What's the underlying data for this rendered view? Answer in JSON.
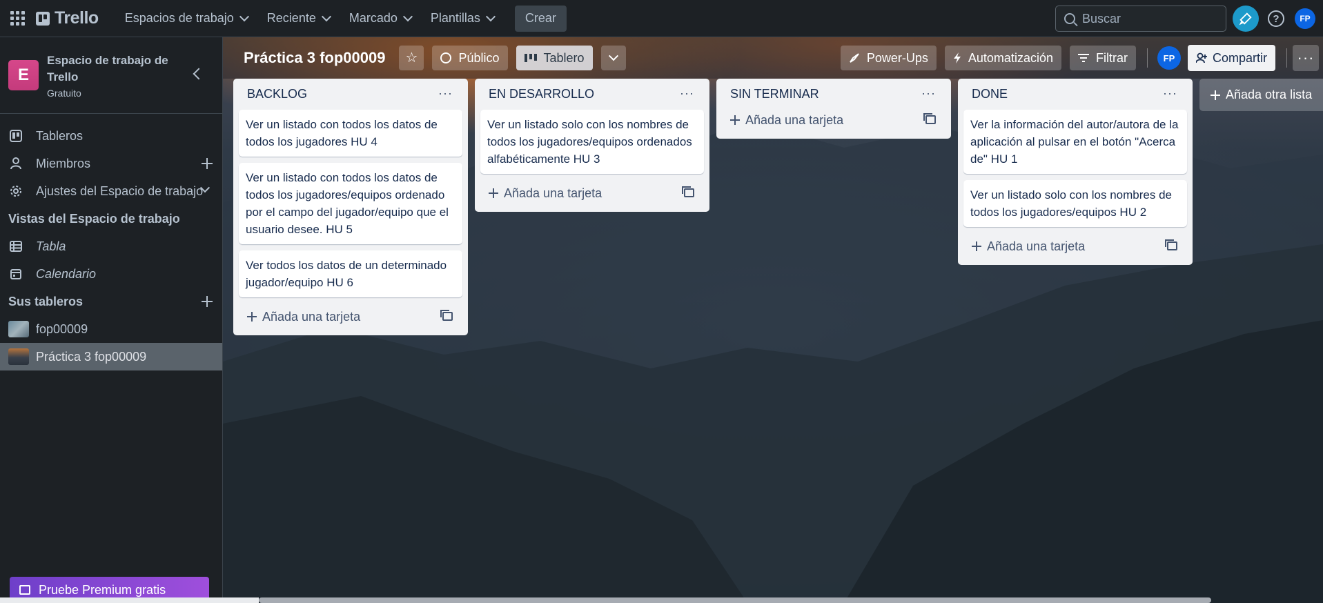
{
  "topbar": {
    "logo": "Trello",
    "nav": [
      "Espacios de trabajo",
      "Reciente",
      "Marcado",
      "Plantillas"
    ],
    "create": "Crear",
    "search_placeholder": "Buscar",
    "avatar": "FP"
  },
  "sidebar": {
    "workspace_initial": "E",
    "workspace_name": "Espacio de trabajo de Trello",
    "workspace_plan": "Gratuito",
    "items": {
      "boards": "Tableros",
      "members": "Miembros",
      "settings": "Ajustes del Espacio de trabajo"
    },
    "views_title": "Vistas del Espacio de trabajo",
    "views": {
      "table": "Tabla",
      "calendar": "Calendario"
    },
    "your_boards_title": "Sus tableros",
    "boards": [
      "fop00009",
      "Práctica 3 fop00009"
    ],
    "premium": "Pruebe Premium gratis"
  },
  "board": {
    "title": "Práctica 3 fop00009",
    "visibility": "Público",
    "view": "Tablero",
    "powerups": "Power-Ups",
    "automation": "Automatización",
    "filter": "Filtrar",
    "avatar": "FP",
    "share": "Compartir",
    "add_list": "Añada otra lista",
    "add_card": "Añada una tarjeta",
    "lists": [
      {
        "title": "BACKLOG",
        "cards": [
          "Ver un listado con todos los datos de todos los jugadores HU 4",
          "Ver un listado con todos los datos de todos los jugadores/equipos ordenado por el campo del jugador/equipo que el usuario desee. HU 5",
          "Ver todos los datos de un determinado jugador/equipo HU 6"
        ]
      },
      {
        "title": "EN DESARROLLO",
        "cards": [
          "Ver un listado solo con los nombres de todos los jugadores/equipos ordenados alfabéticamente HU 3"
        ]
      },
      {
        "title": "SIN TERMINAR",
        "cards": []
      },
      {
        "title": "DONE",
        "cards": [
          "Ver la información del autor/autora de la aplicación al pulsar en el botón \"Acerca de\" HU 1",
          "Ver un listado solo con los nombres de todos los jugadores/equipos HU 2"
        ]
      }
    ]
  },
  "colors": {
    "topbar": "#1d2125",
    "list_bg": "#f1f2f4",
    "workspace_badge": "#c43b7c",
    "notif": "#1d9aca",
    "avatar": "#0c66e4"
  }
}
